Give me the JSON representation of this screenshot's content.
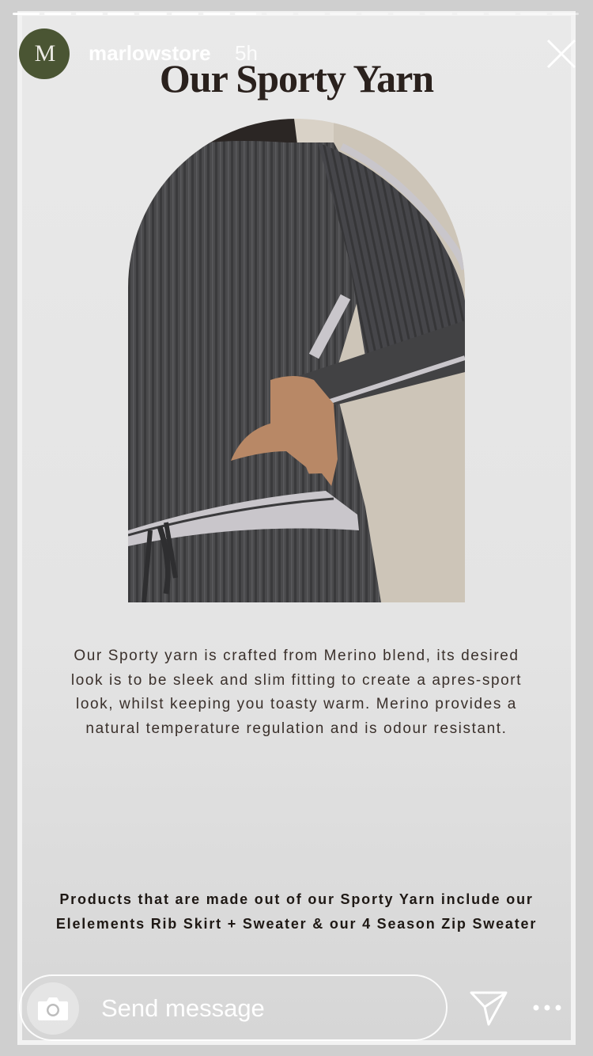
{
  "story": {
    "segments": {
      "total": 18,
      "completed": 7,
      "current_progress": 0.8
    },
    "username": "marlowstore",
    "posted_ago": "5h",
    "avatar": {
      "monogram": "M",
      "color": "#4a5533"
    }
  },
  "post": {
    "headline": "Our Sporty Yarn",
    "body": "Our Sporty yarn is crafted from Merino blend, its desired look is to be sleek and slim fitting to create a apres-sport look, whilst keeping you toasty warm. Merino provides a natural temperature regulation and is odour resistant.",
    "products": "Products that are made out of our Sporty Yarn include our Elelements Rib Skirt + Sweater & our 4 Season Zip Sweater"
  },
  "composer": {
    "placeholder": "Send message"
  },
  "icons": {
    "close": "close-icon",
    "camera": "camera-icon",
    "send": "send-icon",
    "more": "more-icon"
  },
  "colors": {
    "avatar_bg": "#4a5533",
    "headline": "#2a211d",
    "sweater": "#4b4b4d",
    "stripe": "#c9c6cb"
  }
}
